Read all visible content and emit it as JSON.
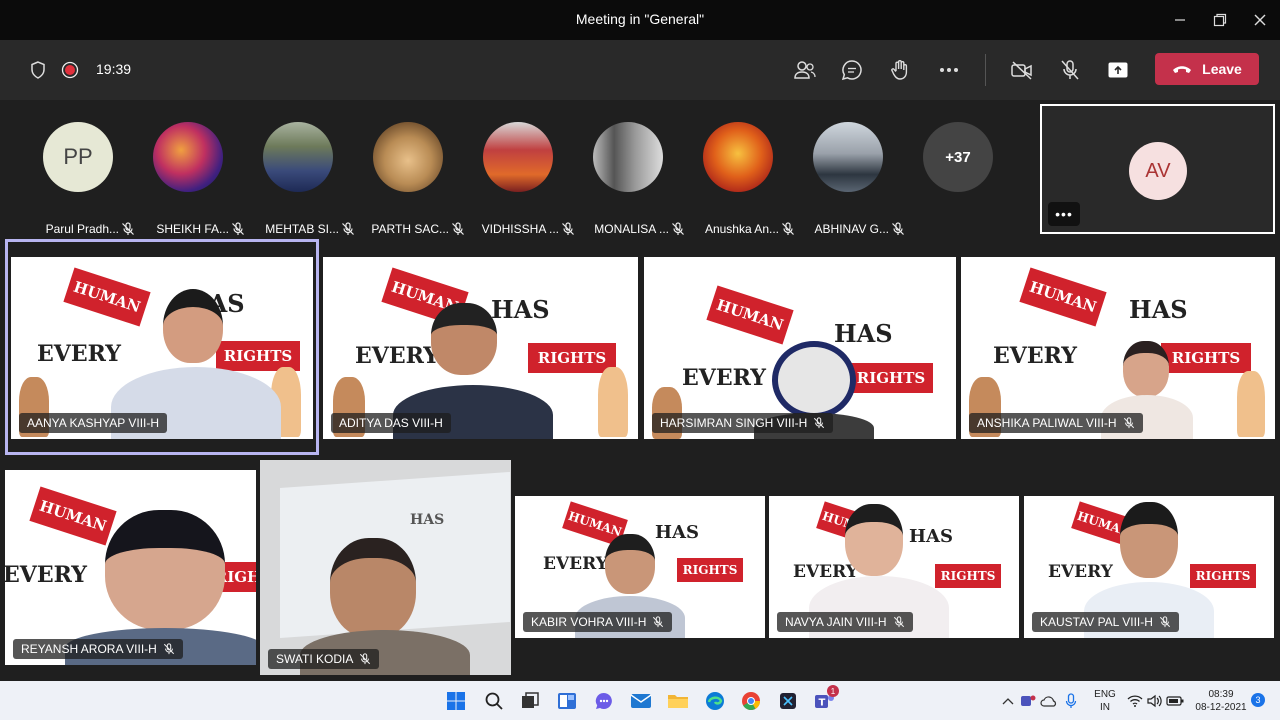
{
  "window": {
    "title": "Meeting in \"General\""
  },
  "toolbar": {
    "timer": "19:39",
    "leave_label": "Leave",
    "accent": "#c4314b"
  },
  "gallery": [
    {
      "name": "Parul Pradh...",
      "initials": "PP",
      "muted": true,
      "avatar_bg": "#e6e8d5",
      "avatar_fg": "#444"
    },
    {
      "name": "SHEIKH FA...",
      "muted": true,
      "avatar_bg": "#5a2f8a"
    },
    {
      "name": "MEHTAB SI...",
      "muted": true,
      "avatar_bg": "#7d6b4b"
    },
    {
      "name": "PARTH SAC...",
      "muted": true,
      "avatar_bg": "#b98c55"
    },
    {
      "name": "VIDHISSHA ...",
      "muted": true,
      "avatar_bg": "#b13a3a"
    },
    {
      "name": "MONALISA ...",
      "muted": true,
      "avatar_bg": "#777"
    },
    {
      "name": "Anushka An...",
      "muted": true,
      "avatar_bg": "#d2581e"
    },
    {
      "name": "ABHINAV G...",
      "muted": true,
      "avatar_bg": "#9aa1aa"
    },
    {
      "name": "",
      "initials": "+37",
      "muted": false,
      "avatar_bg": "#444",
      "avatar_fg": "#fff"
    }
  ],
  "self_view": {
    "initials": "AV",
    "more": "•••"
  },
  "tiles": [
    {
      "name": "AANYA KASHYAP VIII-H",
      "muted": false
    },
    {
      "name": "ADITYA DAS VIII-H",
      "muted": false
    },
    {
      "name": "HARSIMRAN SINGH VIII-H",
      "muted": true
    },
    {
      "name": "ANSHIKA PALIWAL VIII-H",
      "muted": true
    },
    {
      "name": "REYANSH ARORA VIII-H",
      "muted": true
    },
    {
      "name": "SWATI KODIA",
      "muted": true
    },
    {
      "name": "KABIR VOHRA VIII-H",
      "muted": true
    },
    {
      "name": "NAVYA JAIN VIII-H",
      "muted": true
    },
    {
      "name": "KAUSTAV PAL VIII-H",
      "muted": true
    }
  ],
  "background": {
    "word_every": "EVERY",
    "word_has": "HAS",
    "sign_human": "HUMAN",
    "sign_rights": "RIGHTS"
  },
  "taskbar": {
    "lang_top": "ENG",
    "lang_bottom": "IN",
    "time": "08:39",
    "date": "08-12-2021",
    "notification_count": "3",
    "teams_badge": "1"
  }
}
